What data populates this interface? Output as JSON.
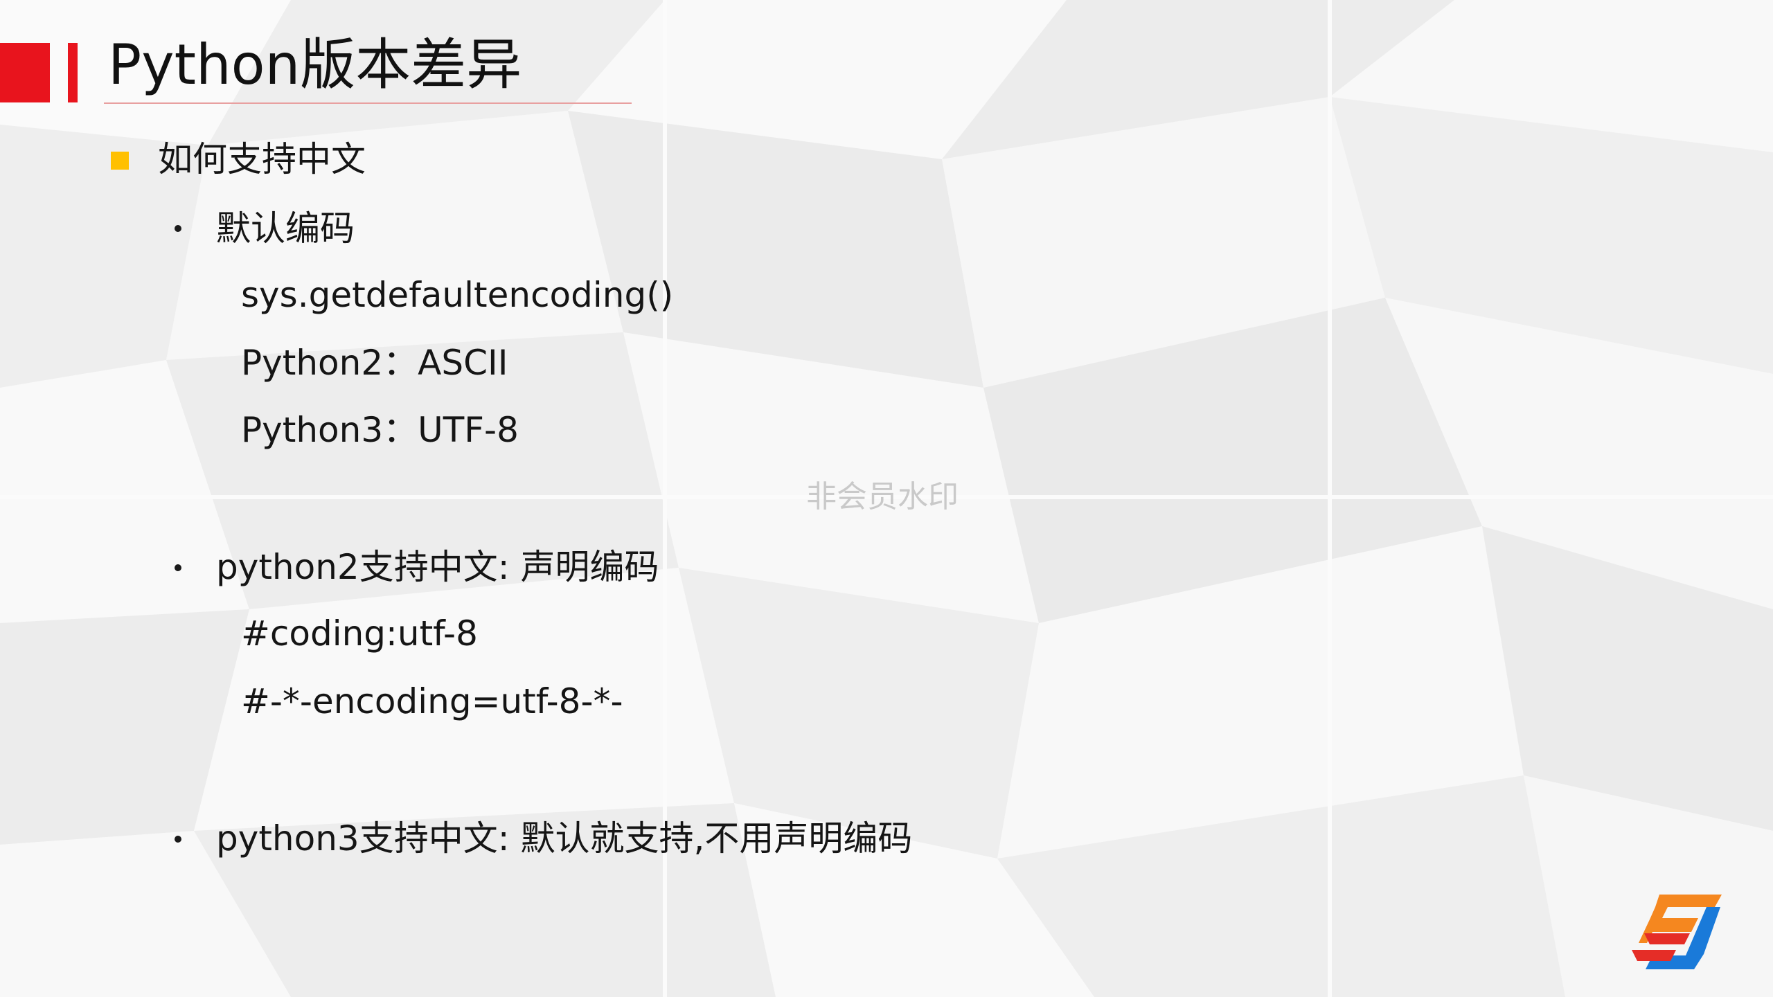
{
  "colors": {
    "accent_red": "#e8141d",
    "square_bullet": "#ffc000",
    "rule": "#e8a0a0",
    "text": "#151515",
    "watermark": "#c9c9c9",
    "logo_orange": "#f5871f",
    "logo_red": "#e52d27",
    "logo_blue": "#1a7ad9"
  },
  "slide": {
    "title": "Python版本差异",
    "section_heading": "如何支持中文",
    "bullet1": {
      "label": "默认编码",
      "lines": [
        "sys.getdefaultencoding()",
        "Python2：ASCII",
        "Python3：UTF-8"
      ]
    },
    "bullet2": {
      "label": "python2支持中文: 声明编码",
      "lines": [
        "#coding:utf-8",
        "#-*-encoding=utf-8-*-"
      ]
    },
    "bullet3": {
      "label": "python3支持中文: 默认就支持,不用声明编码"
    },
    "watermark": "非会员水印",
    "logo_icon": "sj-logo-icon"
  }
}
